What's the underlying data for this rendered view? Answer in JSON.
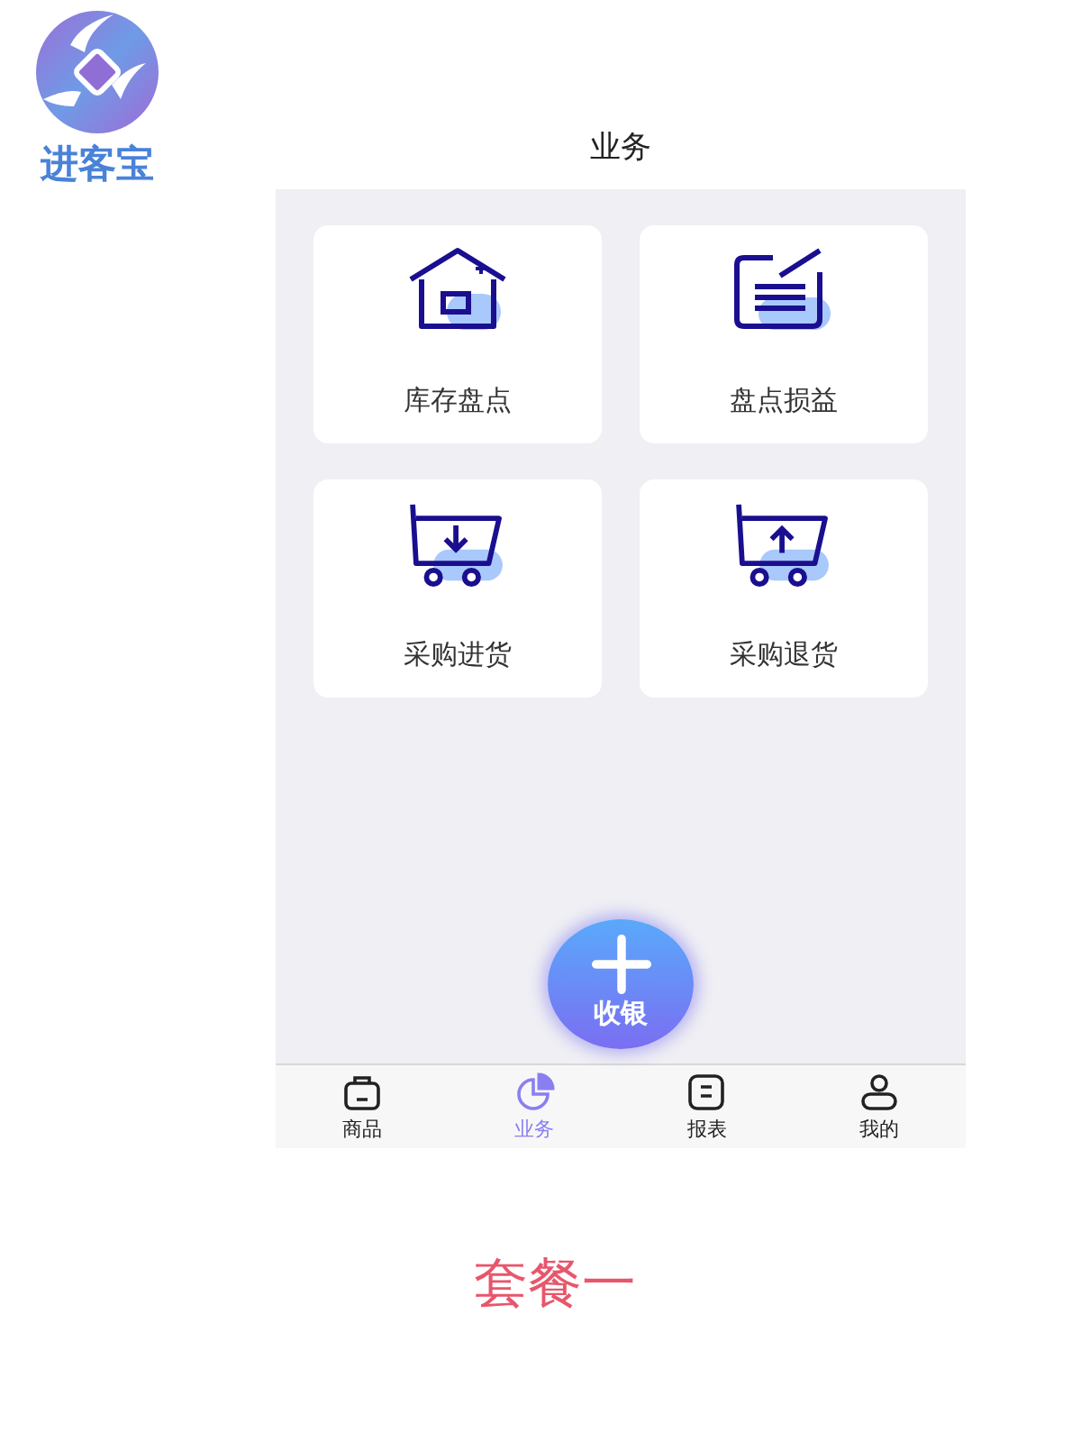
{
  "logo": {
    "text": "进客宝"
  },
  "title": "业务",
  "cards": [
    {
      "label": "库存盘点",
      "kind": "house"
    },
    {
      "label": "盘点损益",
      "kind": "note"
    },
    {
      "label": "采购进货",
      "kind": "cart-in"
    },
    {
      "label": "采购退货",
      "kind": "cart-out"
    }
  ],
  "fab": {
    "label": "收银"
  },
  "tabs": [
    {
      "label": "商品",
      "kind": "bag",
      "selected": false
    },
    {
      "label": "业务",
      "kind": "pie",
      "selected": true
    },
    {
      "label": "报表",
      "kind": "report",
      "selected": false
    },
    {
      "label": "我的",
      "kind": "user",
      "selected": false
    }
  ],
  "caption": "套餐一"
}
